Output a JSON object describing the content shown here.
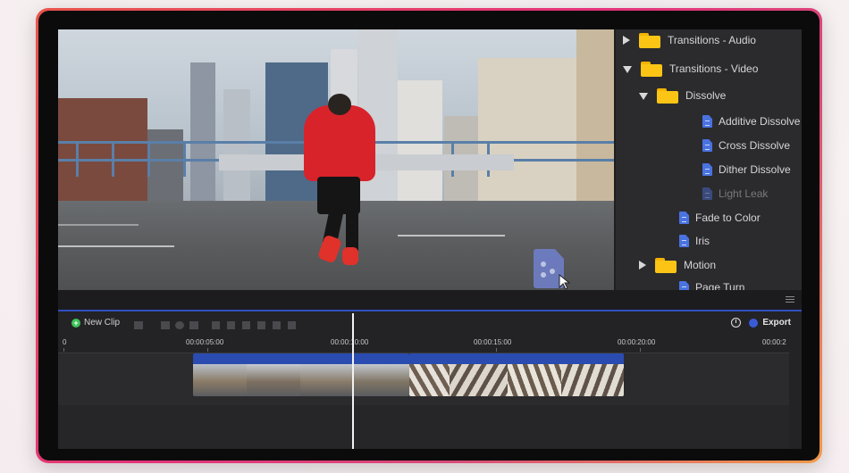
{
  "tree": {
    "items": [
      {
        "label": "Transitions - Audio",
        "kind": "folder",
        "state": "collapsed",
        "indent": 0
      },
      {
        "label": "Transitions - Video",
        "kind": "folder",
        "state": "expanded",
        "indent": 0
      },
      {
        "label": "Dissolve",
        "kind": "folder",
        "state": "expanded",
        "indent": 1
      },
      {
        "label": "Additive Dissolve",
        "kind": "file",
        "indent": 2
      },
      {
        "label": "Cross Dissolve",
        "kind": "file",
        "indent": 2
      },
      {
        "label": "Dither Dissolve",
        "kind": "file",
        "indent": 2
      },
      {
        "label": "Light Leak",
        "kind": "file",
        "indent": 2,
        "disabled": true
      },
      {
        "label": "Fade to Color",
        "kind": "file",
        "indent": 1
      },
      {
        "label": "Iris",
        "kind": "file",
        "indent": 1
      },
      {
        "label": "Motion",
        "kind": "folder",
        "state": "collapsed",
        "indent": 1
      },
      {
        "label": "Page Turn",
        "kind": "file",
        "indent": 1
      }
    ]
  },
  "toolbar": {
    "new_clip_label": "New Clip",
    "export_label": "Export"
  },
  "ruler": {
    "labels": [
      "0",
      "00:00:05:00",
      "00:00:10:00",
      "00:00:15:00",
      "00:00:20:00",
      "00:00:2"
    ]
  },
  "icons": {
    "new_clip": "plus-circle-icon",
    "clock": "clock-icon",
    "export": "export-icon",
    "menu": "hamburger-icon",
    "drag_file": "transition-file-icon"
  },
  "colors": {
    "accent_blue": "#2f4fbf",
    "folder_yellow": "#fcc515",
    "file_blue": "#4a73e0",
    "new_clip_green": "#3cc157",
    "device_gradient": [
      "#e8554c",
      "#e4327a",
      "#f09a4a"
    ]
  }
}
